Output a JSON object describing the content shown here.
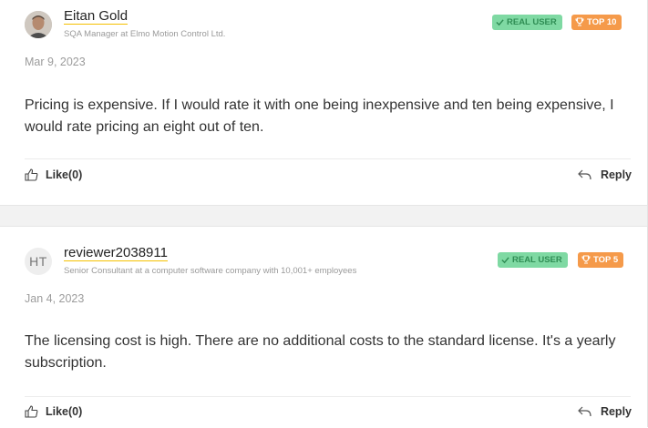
{
  "reviews": [
    {
      "name": "Eitan Gold",
      "subtitle": "SQA Manager at Elmo Motion Control Ltd.",
      "avatar_type": "photo",
      "badges": {
        "real_user": "REAL USER",
        "top": "TOP 10"
      },
      "date": "Mar 9, 2023",
      "text": "Pricing is expensive. If I would rate it with one being inexpensive and ten being expensive, I would rate pricing an eight out of ten.",
      "like_label": "Like(0)",
      "reply_label": "Reply"
    },
    {
      "name": "reviewer2038911",
      "initials": "HT",
      "avatar_type": "initials",
      "subtitle": "Senior Consultant at a computer software company with 10,001+ employees",
      "badges": {
        "real_user": "REAL USER",
        "top": "TOP 5"
      },
      "date": "Jan 4, 2023",
      "text": "The licensing cost is high. There are no additional costs to the standard license. It's a yearly subscription.",
      "like_label": "Like(0)",
      "reply_label": "Reply"
    }
  ],
  "colors": {
    "real_user_bg": "#7fd9a3",
    "top_badge_bg": "#f59a4a",
    "name_underline": "#f5c000"
  },
  "icons": [
    "check-icon",
    "trophy-icon",
    "thumbs-up-icon",
    "reply-arrow-icon"
  ]
}
